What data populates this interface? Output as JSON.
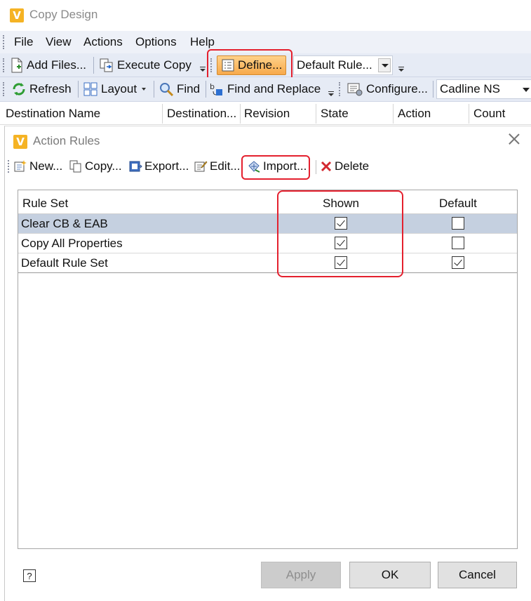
{
  "window": {
    "title": "Copy Design",
    "menu": [
      "File",
      "View",
      "Actions",
      "Options",
      "Help"
    ]
  },
  "toolbar1": {
    "add_files": "Add Files...",
    "execute_copy": "Execute Copy",
    "define": "Define...",
    "rule_combo": "Default Rule..."
  },
  "toolbar2": {
    "refresh": "Refresh",
    "layout": "Layout",
    "find": "Find",
    "find_replace": "Find and Replace",
    "configure": "Configure...",
    "config_combo": "Cadline NS"
  },
  "columns": [
    "Destination Name",
    "Destination...",
    "Revision",
    "State",
    "Action",
    "Count"
  ],
  "dialog": {
    "title": "Action Rules",
    "toolbar": {
      "new": "New...",
      "copy": "Copy...",
      "export": "Export...",
      "edit": "Edit...",
      "import": "Import...",
      "delete": "Delete"
    },
    "grid": {
      "headers": {
        "rule_set": "Rule Set",
        "shown": "Shown",
        "default": "Default"
      },
      "rows": [
        {
          "name": "Clear CB & EAB",
          "shown": true,
          "default": false,
          "selected": true
        },
        {
          "name": "Copy All Properties",
          "shown": true,
          "default": false,
          "selected": false
        },
        {
          "name": "Default Rule Set",
          "shown": true,
          "default": true,
          "selected": false
        }
      ]
    },
    "help": "?",
    "buttons": {
      "apply": "Apply",
      "ok": "OK",
      "cancel": "Cancel"
    }
  },
  "colors": {
    "highlight_box": "#e4202e",
    "selected_row": "#c5d0e0",
    "define_button": "#f7a94a"
  }
}
